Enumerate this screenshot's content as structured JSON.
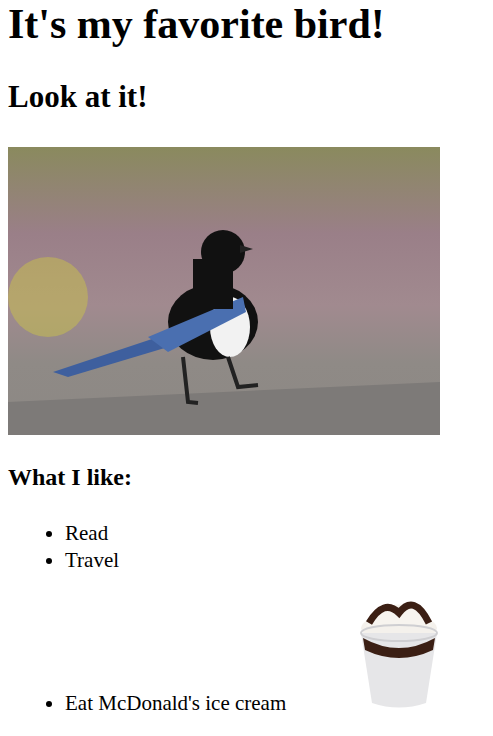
{
  "page": {
    "title": "It's my favorite bird!",
    "subtitle": "Look at it!"
  },
  "likes": {
    "heading": "What I like:",
    "items": [
      {
        "label": "Read",
        "kind": "text"
      },
      {
        "label": "Travel",
        "kind": "text"
      },
      {
        "label": "Eat McDonald's ice cream",
        "kind": "with-image"
      }
    ]
  }
}
